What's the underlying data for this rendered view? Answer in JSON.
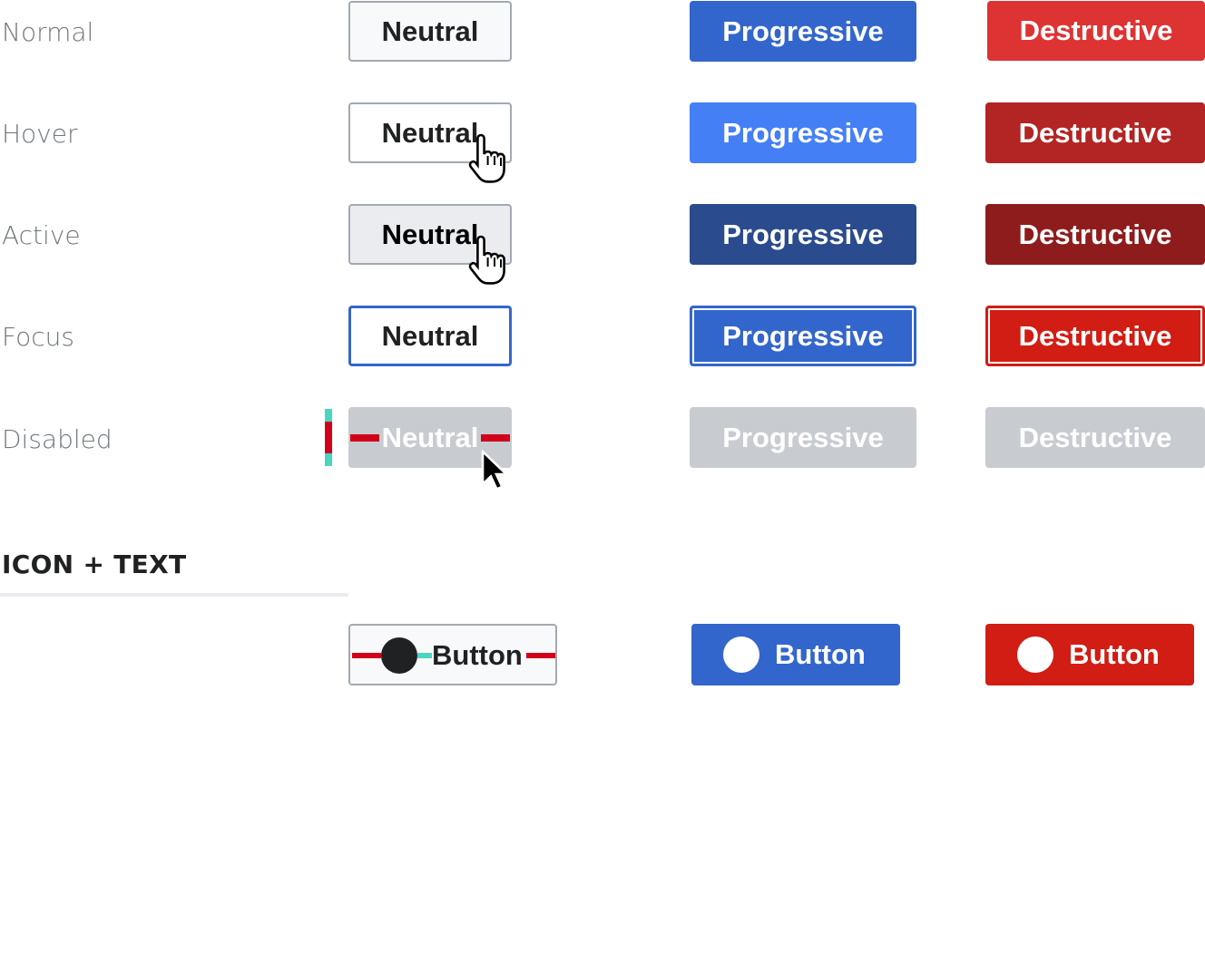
{
  "rows": {
    "normal": "Normal",
    "hover": "Hover",
    "active": "Active",
    "focus": "Focus",
    "disabled": "Disabled"
  },
  "buttons": {
    "neutral": "Neutral",
    "progressive": "Progressive",
    "destructive": "Destructive"
  },
  "icon_section": {
    "title": "ICON + TEXT",
    "button_label": "Button"
  },
  "colors": {
    "progressive": "#3366cc",
    "progressive_hover": "#447ff5",
    "progressive_active": "#2a4b8d",
    "destructive": "#dd3333",
    "destructive_hover": "#b32424",
    "destructive_active": "#8f1c1c",
    "disabled": "#c8ccd1",
    "spacing_red": "#d0021b",
    "spacing_teal": "#4ad5c0"
  },
  "icons": {
    "hand_cursor": "hand-pointer-icon",
    "arrow_cursor": "arrow-pointer-icon",
    "circle": "circle-icon"
  }
}
